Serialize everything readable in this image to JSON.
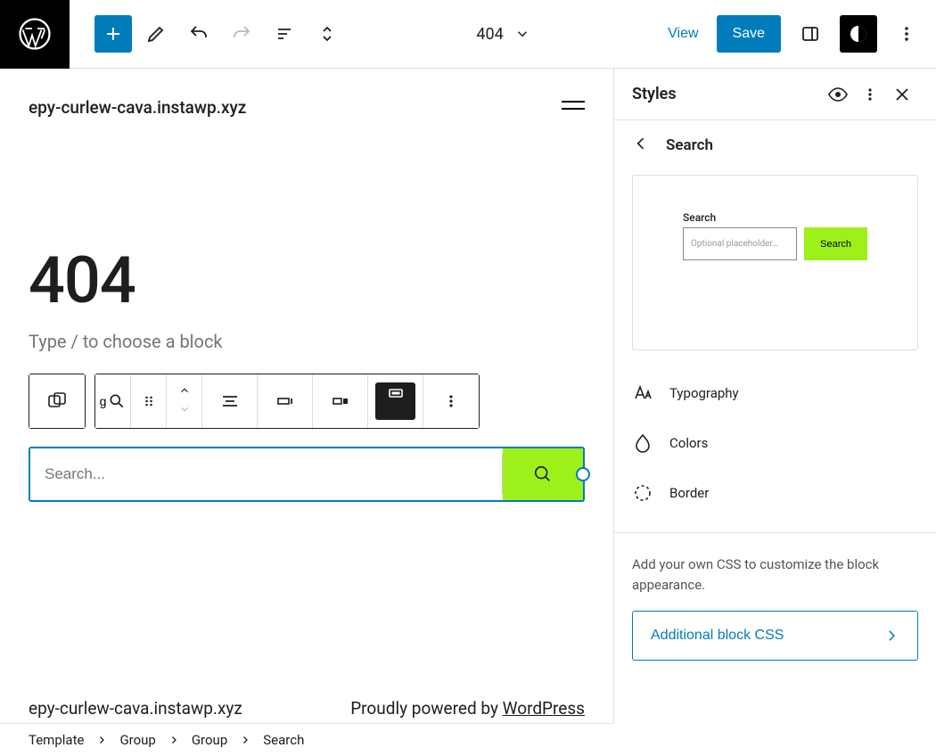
{
  "toolbar": {
    "doc_title": "404",
    "view_label": "View",
    "save_label": "Save"
  },
  "editor": {
    "site_title": "epy-curlew-cava.instawp.xyz",
    "headline": "404",
    "type_prompt": "Type / to choose a block",
    "search_placeholder": "Search...",
    "footer_site": "epy-curlew-cava.instawp.xyz",
    "footer_powered": "Proudly powered by ",
    "footer_link": "WordPress"
  },
  "styles_panel": {
    "header_title": "Styles",
    "nav_title": "Search",
    "preview": {
      "label": "Search",
      "placeholder": "Optional placeholder…",
      "button": "Search"
    },
    "items": {
      "typography": "Typography",
      "colors": "Colors",
      "border": "Border"
    },
    "css_section": {
      "description": "Add your own CSS to customize the block appearance.",
      "button_label": "Additional block CSS"
    }
  },
  "breadcrumbs": [
    "Template",
    "Group",
    "Group",
    "Search"
  ]
}
